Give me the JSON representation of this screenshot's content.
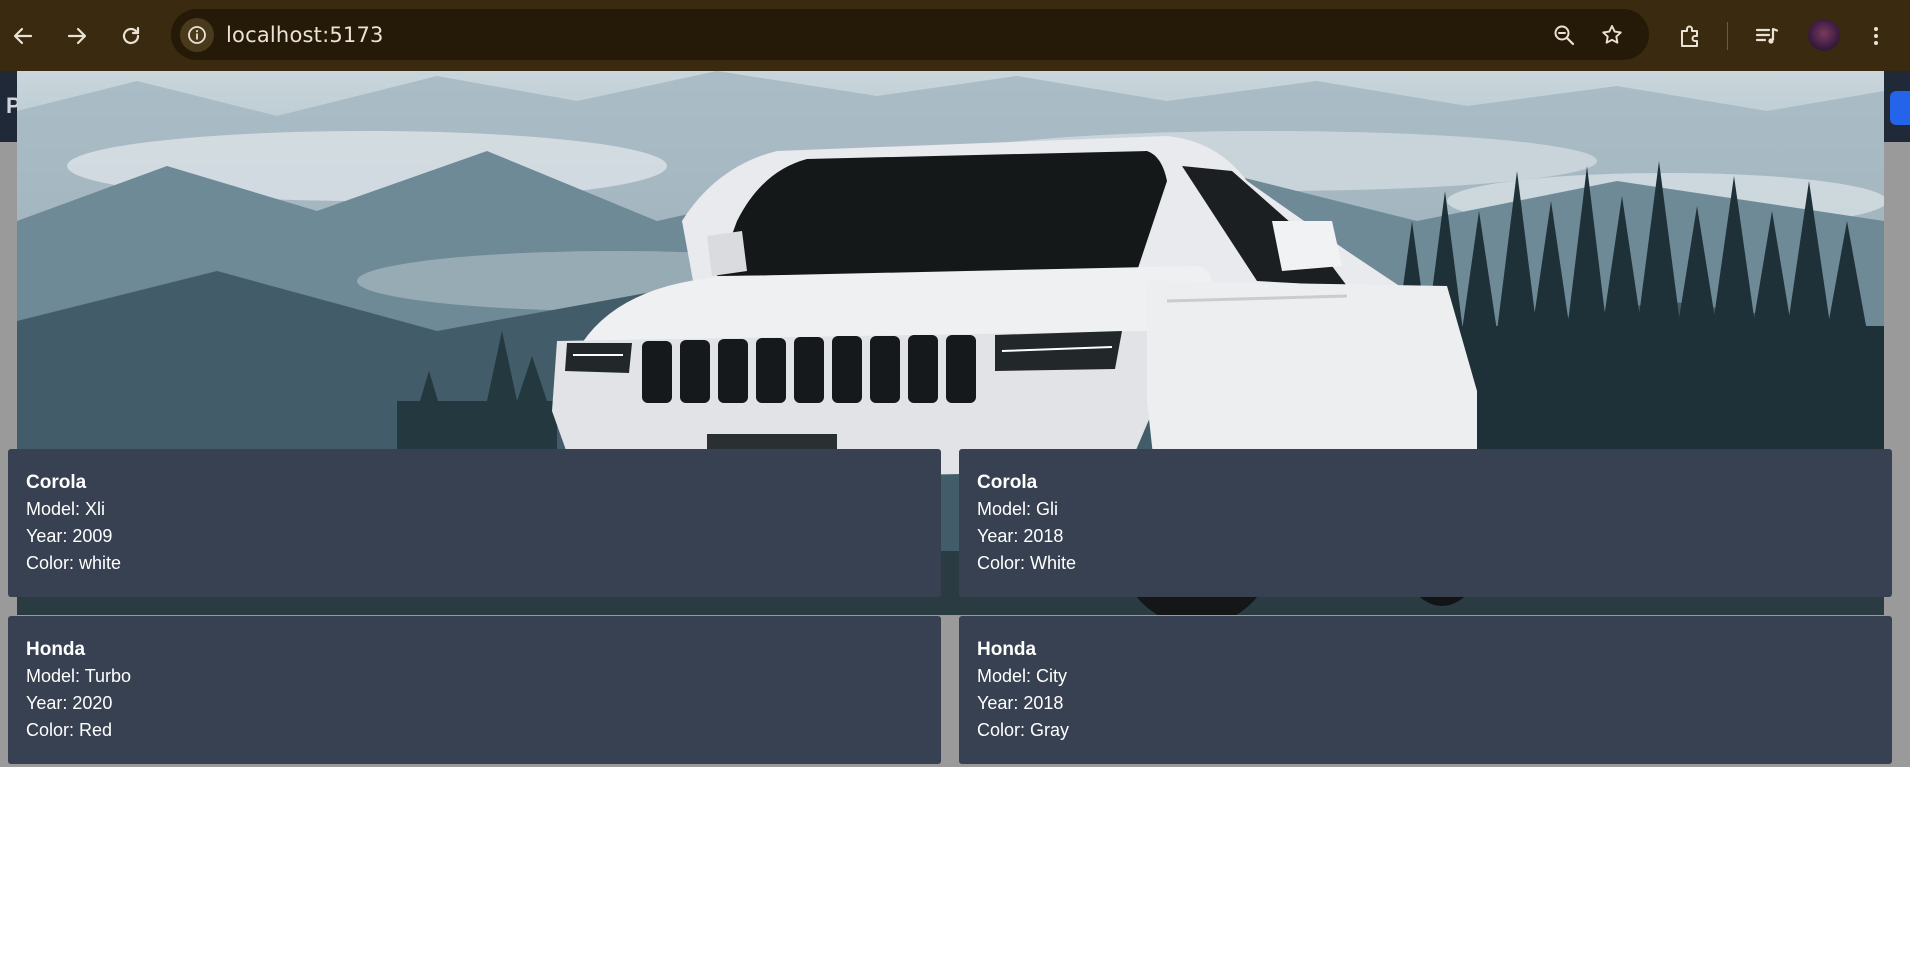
{
  "browser": {
    "url": "localhost:5173",
    "icons": [
      "back-icon",
      "forward-icon",
      "reload-icon",
      "site-info-icon",
      "zoom-out-icon",
      "bookmark-star-icon",
      "extensions-icon",
      "media-control-icon",
      "profile-avatar",
      "more-menu-icon"
    ]
  },
  "app": {
    "nav_letter": "P"
  },
  "labels": {
    "model": "Model:",
    "year": "Year:",
    "color": "Color:"
  },
  "cars": [
    {
      "make": "Corola",
      "model": "Xli",
      "year": "2009",
      "color": "white"
    },
    {
      "make": "Corola",
      "model": "Gli",
      "year": "2018",
      "color": "White"
    },
    {
      "make": "Honda",
      "model": "Turbo",
      "year": "2020",
      "color": "Red"
    },
    {
      "make": "Honda",
      "model": "City",
      "year": "2018",
      "color": "Gray"
    }
  ],
  "colors": {
    "chrome_bg": "#3a2a10",
    "omnibox_bg": "#251a07",
    "card_bg": "#374151",
    "nav_bg": "#1f2937"
  }
}
